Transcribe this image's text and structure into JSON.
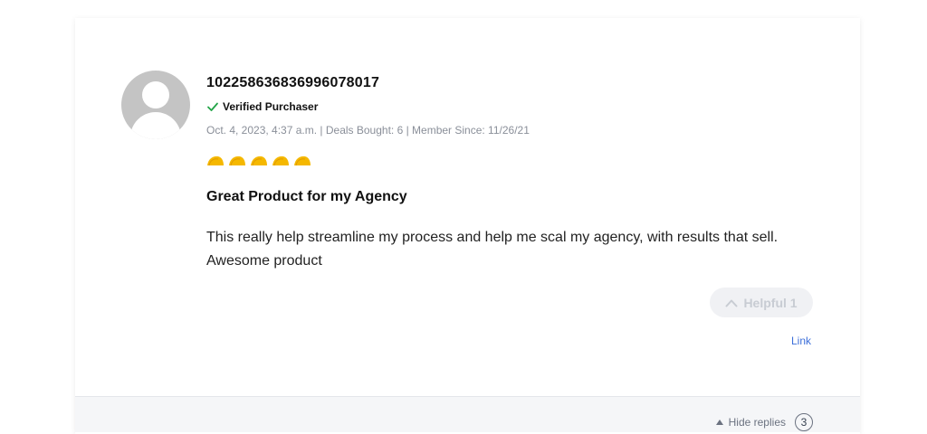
{
  "review": {
    "username": "102258636836996078017",
    "verified_label": "Verified Purchaser",
    "meta": "Oct. 4, 2023, 4:37 a.m. | Deals Bought: 6 | Member Since: 11/26/21",
    "rating": 5,
    "rating_max": 5,
    "title": "Great Product for my Agency",
    "body": "This really help streamline my process and help me scal my agency, with results that sell. Awesome product",
    "helpful_label": "Helpful 1",
    "link_label": "Link"
  },
  "replies": {
    "toggle_label": "Hide replies",
    "count": "3"
  },
  "colors": {
    "verified_check": "#22a447",
    "taco": "#f5b800",
    "link": "#3d6fd9"
  },
  "icons": {
    "avatar": "default-user-avatar",
    "verified": "check-icon",
    "rating": "taco-icon",
    "helpful": "chevron-up-icon",
    "hide_replies": "triangle-up-icon"
  }
}
